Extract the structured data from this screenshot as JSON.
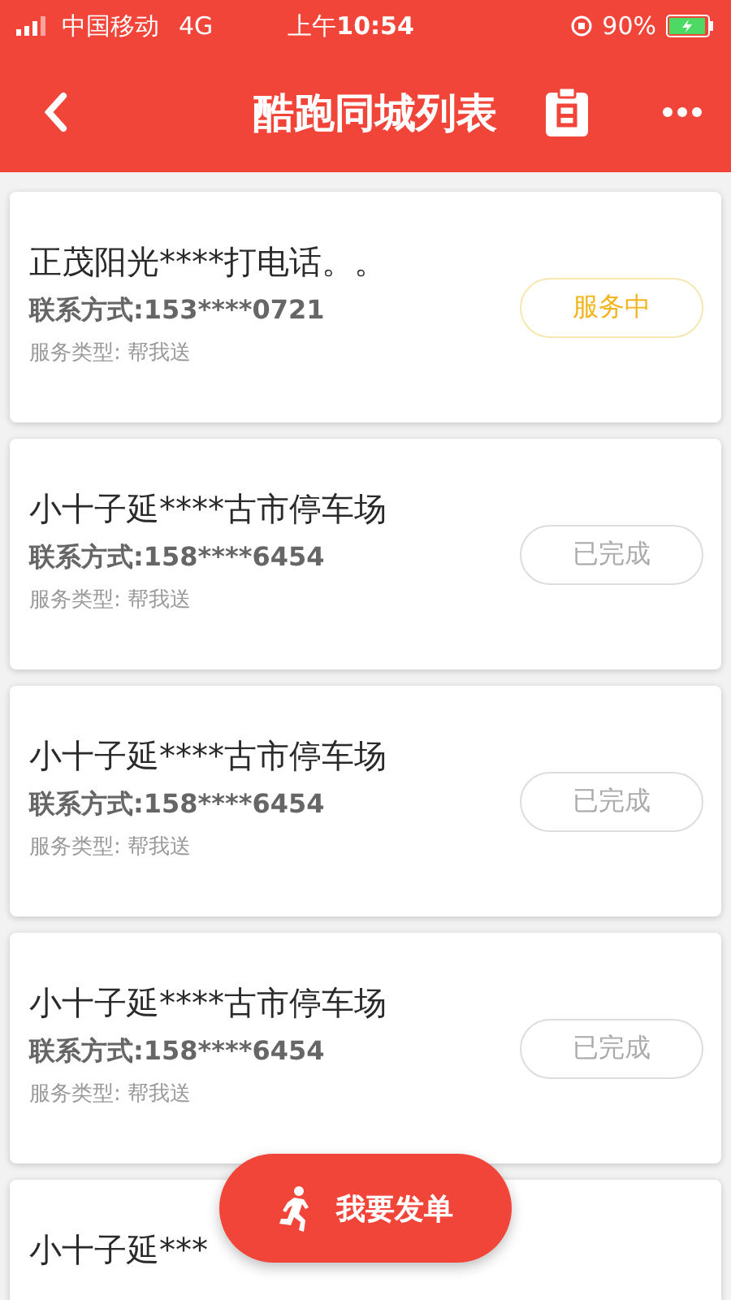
{
  "status_bar": {
    "carrier": "中国移动",
    "network": "4G",
    "time_prefix": "上午",
    "time": "10:54",
    "battery": "90%"
  },
  "header": {
    "title": "酷跑同城列表"
  },
  "orders": [
    {
      "title": "正茂阳光****打电话。。",
      "contact": "联系方式:153****0721",
      "service": "服务类型: 帮我送",
      "status": "服务中",
      "kind": "active"
    },
    {
      "title": "小十子延****古市停车场",
      "contact": "联系方式:158****6454",
      "service": "服务类型: 帮我送",
      "status": "已完成",
      "kind": "done"
    },
    {
      "title": "小十子延****古市停车场",
      "contact": "联系方式:158****6454",
      "service": "服务类型: 帮我送",
      "status": "已完成",
      "kind": "done"
    },
    {
      "title": "小十子延****古市停车场",
      "contact": "联系方式:158****6454",
      "service": "服务类型: 帮我送",
      "status": "已完成",
      "kind": "done"
    },
    {
      "title": "小十子延***"
    }
  ],
  "fab": {
    "label": "我要发单"
  }
}
